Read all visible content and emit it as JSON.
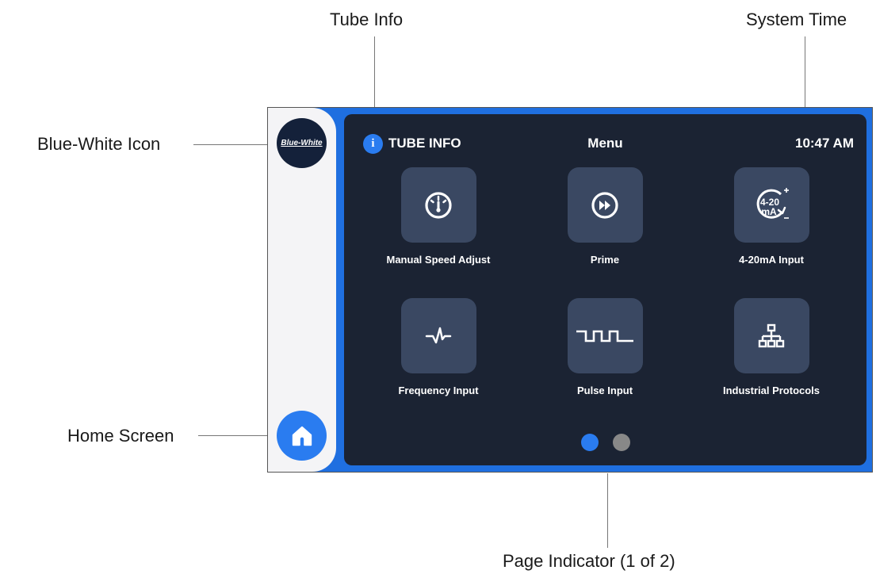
{
  "annotations": {
    "tube_info": "Tube Info",
    "system_time": "System Time",
    "blue_white_icon": "Blue-White Icon",
    "home_screen": "Home Screen",
    "page_indicator": "Page Indicator (1 of 2)"
  },
  "sidebar": {
    "logo_text": "Blue-White",
    "home_icon": "home-icon"
  },
  "header": {
    "info_icon_glyph": "i",
    "tube_info_label": "TUBE INFO",
    "title": "Menu",
    "time": "10:47 AM"
  },
  "menu_items": [
    {
      "label": "Manual Speed Adjust",
      "icon": "speedometer-icon"
    },
    {
      "label": "Prime",
      "icon": "fast-forward-icon"
    },
    {
      "label": "4-20mA Input",
      "icon": "current-loop-icon",
      "icon_text": "4-20",
      "icon_unit": "mA"
    },
    {
      "label": "Frequency Input",
      "icon": "pulse-wave-icon"
    },
    {
      "label": "Pulse Input",
      "icon": "square-wave-icon"
    },
    {
      "label": "Industrial Protocols",
      "icon": "network-hierarchy-icon"
    }
  ],
  "pagination": {
    "current_page": 1,
    "total_pages": 2
  },
  "colors": {
    "accent": "#2a7cf0",
    "screen_bg": "#1b2333",
    "tile_bg": "#3a4862",
    "dot_inactive": "#888888"
  }
}
